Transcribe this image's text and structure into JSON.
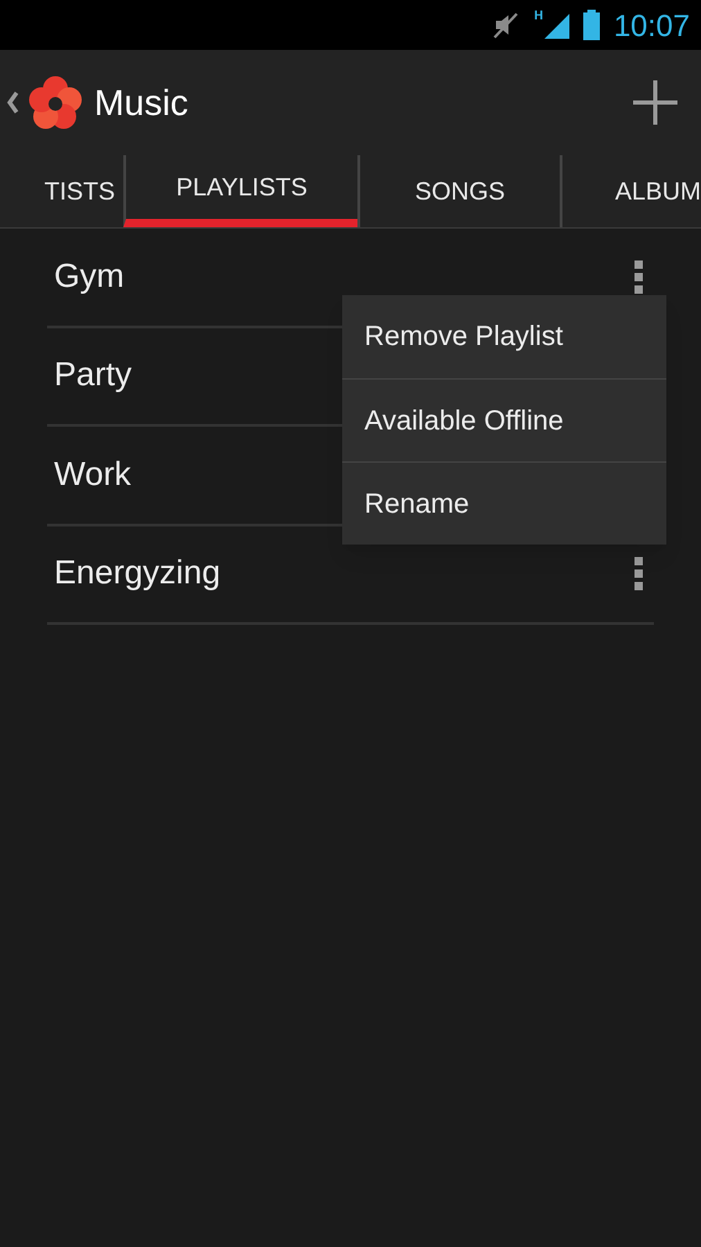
{
  "status_bar": {
    "network": "H",
    "time": "10:07"
  },
  "action_bar": {
    "title": "Music"
  },
  "tabs": [
    {
      "label": "TISTS",
      "selected": false
    },
    {
      "label": "PLAYLISTS",
      "selected": true
    },
    {
      "label": "SONGS",
      "selected": false
    },
    {
      "label": "ALBUM",
      "selected": false
    }
  ],
  "playlists": [
    {
      "name": "Gym",
      "menu_open": true
    },
    {
      "name": "Party",
      "menu_open": false
    },
    {
      "name": "Work",
      "menu_open": false
    },
    {
      "name": "Energyzing",
      "menu_open": false
    }
  ],
  "popup_menu": {
    "items": [
      "Remove Playlist",
      "Available Offline",
      "Rename"
    ]
  }
}
